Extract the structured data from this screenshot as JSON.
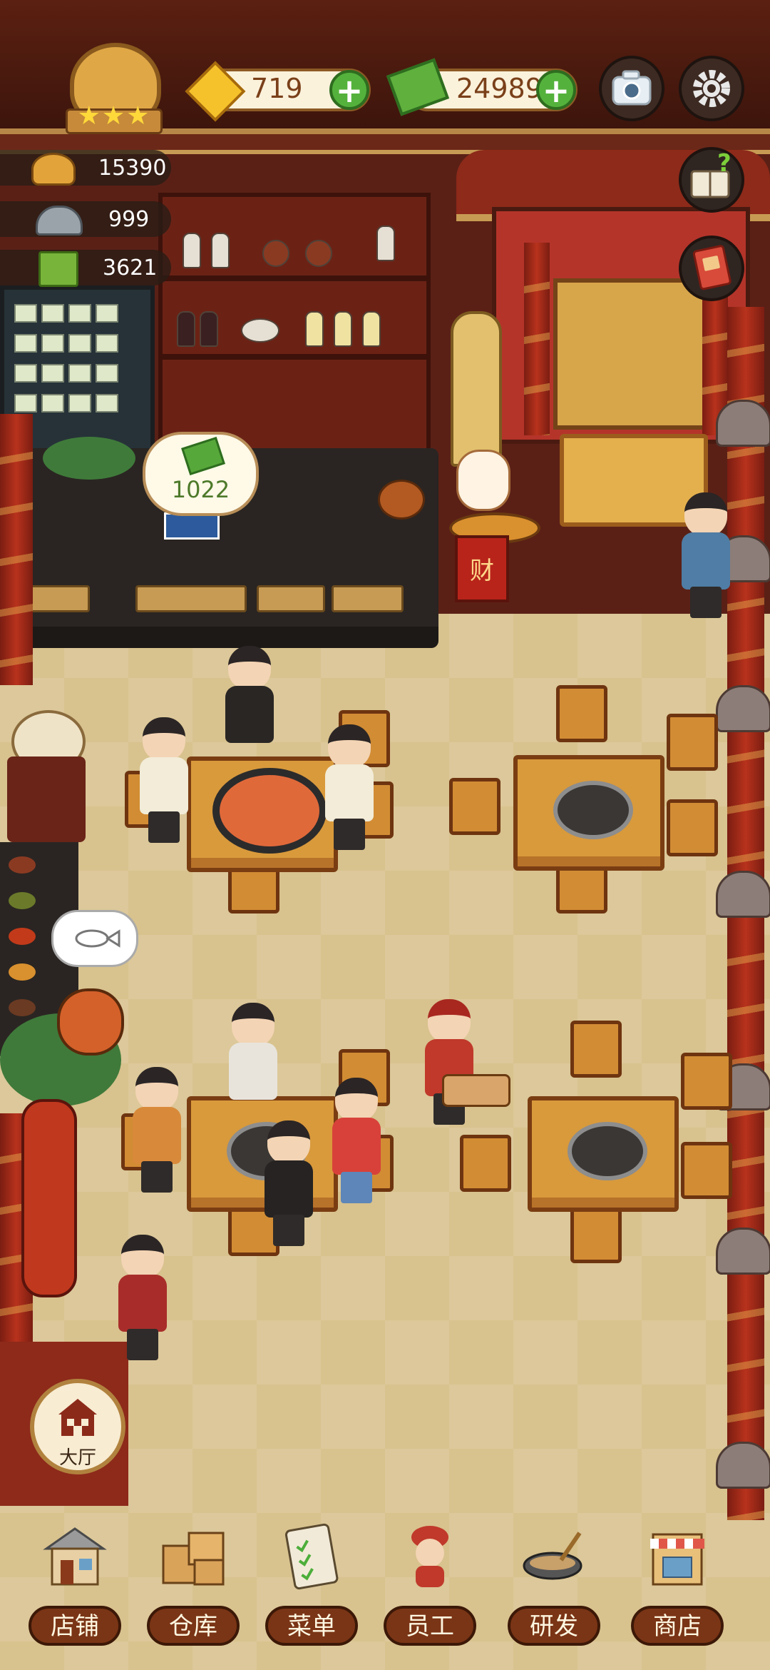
{
  "hud": {
    "gems": "719",
    "cash": "24989"
  },
  "stats": {
    "hotpot_count": "15390",
    "dish_count": "999",
    "recipe_count": "3621"
  },
  "bubble": {
    "tip_amount": "1022"
  },
  "scene": {
    "fortune_sign": "财"
  },
  "hall_button": {
    "label": "大厅"
  },
  "bottom_nav": [
    {
      "label": "店铺",
      "icon": "shop-building-icon"
    },
    {
      "label": "仓库",
      "icon": "warehouse-boxes-icon"
    },
    {
      "label": "菜单",
      "icon": "menu-clipboard-icon"
    },
    {
      "label": "员工",
      "icon": "staff-chef-icon"
    },
    {
      "label": "研发",
      "icon": "research-wok-icon"
    },
    {
      "label": "商店",
      "icon": "store-stall-icon"
    }
  ],
  "colors": {
    "accent_green": "#54b23c",
    "wood_brown": "#7a3516",
    "gold": "#c79b53"
  }
}
